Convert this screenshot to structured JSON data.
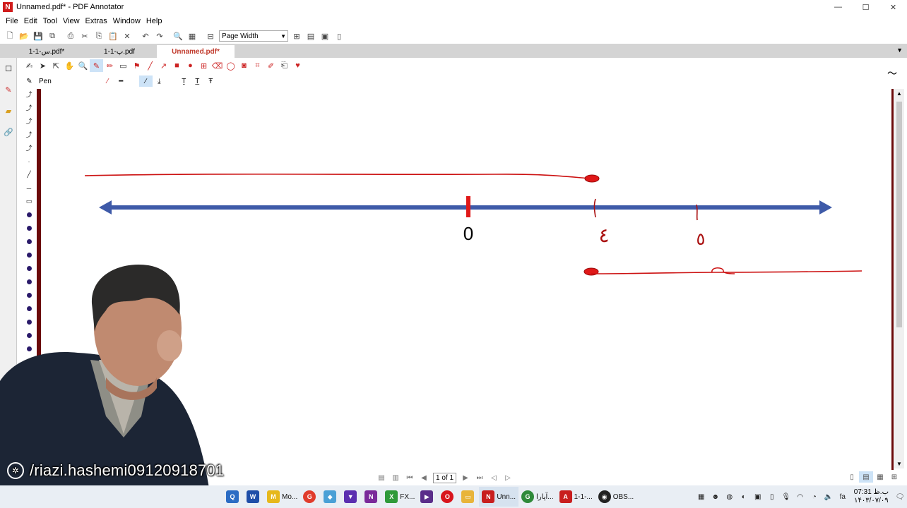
{
  "window": {
    "title": "Unnamed.pdf* - PDF Annotator",
    "app_icon_letter": "N",
    "min": "—",
    "max": "☐",
    "close": "✕"
  },
  "menu": [
    "File",
    "Edit",
    "Tool",
    "View",
    "Extras",
    "Window",
    "Help"
  ],
  "toolbar": {
    "zoom": "Page Width"
  },
  "tabs": [
    {
      "label": "1-1-س.pdf*",
      "active": false
    },
    {
      "label": "1-1-پ.pdf",
      "active": false
    },
    {
      "label": "Unnamed.pdf*",
      "active": true
    }
  ],
  "pen_toolbar": {
    "tool_label": "Pen"
  },
  "diagram": {
    "zero_label": "0",
    "mark_label_1": "٤",
    "mark_label_2": "٥",
    "colors": {
      "axis": "#3e5aa8",
      "ink": "#cc1111",
      "zero_tick": "#e01818"
    }
  },
  "page_nav": {
    "indicator": "1 of 1"
  },
  "watermark": "/riazi.hashemi09120918701",
  "taskbar": {
    "items": [
      {
        "label": "",
        "color": "#2b6cc4",
        "icon": "Q"
      },
      {
        "label": "",
        "color": "#1f4ea8",
        "icon": "W"
      },
      {
        "label": "Mo...",
        "color": "#e6b81c",
        "icon": "M"
      },
      {
        "label": "",
        "color": "#e03c2c",
        "icon": "G"
      },
      {
        "label": "",
        "color": "#4aa0d6",
        "icon": "◆"
      },
      {
        "label": "",
        "color": "#5b2fb0",
        "icon": "▼"
      },
      {
        "label": "",
        "color": "#7a2a9a",
        "icon": "N"
      },
      {
        "label": "FX...",
        "color": "#2f9a3a",
        "icon": "X"
      },
      {
        "label": "",
        "color": "#5a2d8a",
        "icon": "▶"
      },
      {
        "label": "",
        "color": "#d8141c",
        "icon": "O"
      },
      {
        "label": "",
        "color": "#e8b43a",
        "icon": "▭"
      },
      {
        "label": "Unn...",
        "color": "#c81e1e",
        "icon": "N"
      },
      {
        "label": "آپارا...",
        "color": "#2f8a3a",
        "icon": "G"
      },
      {
        "label": "1-1-...",
        "color": "#c81e1e",
        "icon": "A"
      },
      {
        "label": "OBS...",
        "color": "#222222",
        "icon": "◉"
      }
    ],
    "clock_time": "07:31 ب.ظ",
    "clock_date": "۱۴۰۳/۰۷/۰۹",
    "lang": "fa"
  }
}
